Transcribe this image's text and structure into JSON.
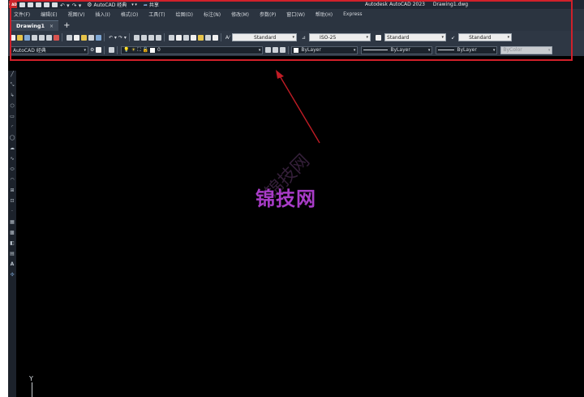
{
  "titlebar": {
    "logo": "CAD",
    "workspace": "AutoCAD 经典",
    "share": "共享",
    "app_name": "Autodesk AutoCAD 2023",
    "doc_name": "Drawing1.dwg"
  },
  "menu": [
    "文件(F)",
    "编辑(E)",
    "视图(V)",
    "插入(I)",
    "格式(O)",
    "工具(T)",
    "绘图(D)",
    "标注(N)",
    "修改(M)",
    "参数(P)",
    "窗口(W)",
    "帮助(H)",
    "Express"
  ],
  "tabs": {
    "active": "Drawing1",
    "close": "×",
    "add": "+"
  },
  "styles": {
    "text_style": "Standard",
    "dim_style": "ISO-25",
    "table_style": "Standard",
    "mleader_style": "Standard"
  },
  "layers": {
    "workspace_combo": "AutoCAD 经典",
    "current_layer": "0",
    "color": "ByLayer",
    "linetype": "ByLayer",
    "lineweight": "ByLayer",
    "plotstyle": "ByColor"
  },
  "ucs": {
    "y_label": "Y"
  },
  "watermark": {
    "text": "锦技网"
  },
  "colors": {
    "highlight": "#d0202a",
    "watermark": "#a83cc7",
    "canvas": "#000000"
  }
}
